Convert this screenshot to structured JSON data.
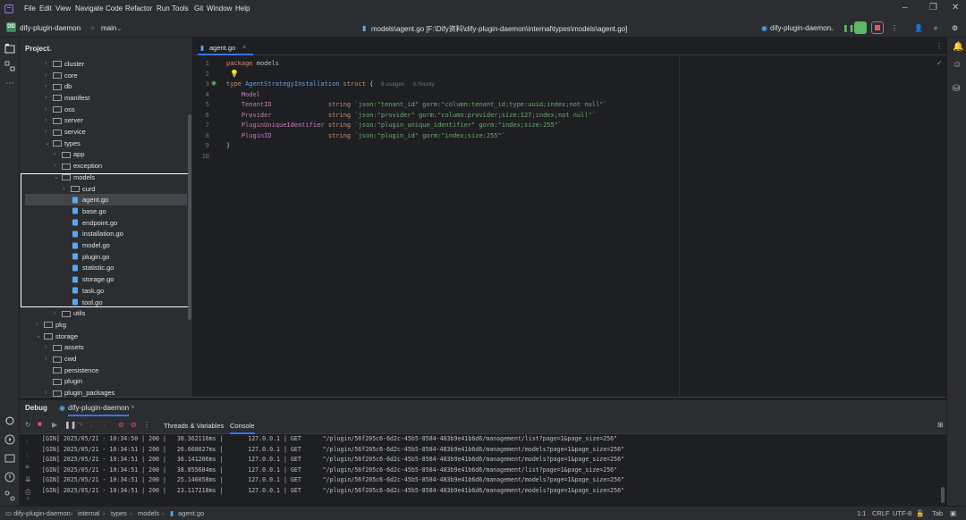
{
  "menu": [
    "File",
    "Edit",
    "View",
    "Navigate",
    "Code",
    "Refactor",
    "Run",
    "Tools",
    "Git",
    "Window",
    "Help"
  ],
  "toolbar": {
    "project_badge": "DD",
    "project_name": "dify-plugin-daemon",
    "branch": "main",
    "path": "models\\agent.go [F:\\Dify资料\\dify-plugin-daemon\\internal\\types\\models\\agent.go]",
    "run_config": "dify-plugin-daemon"
  },
  "project": {
    "header": "Project",
    "tree": [
      {
        "label": "cluster",
        "type": "folder",
        "exp": "closed"
      },
      {
        "label": "core",
        "type": "folder",
        "exp": "closed"
      },
      {
        "label": "db",
        "type": "folder",
        "exp": "closed"
      },
      {
        "label": "manifest",
        "type": "folder",
        "exp": "closed"
      },
      {
        "label": "oss",
        "type": "folder",
        "exp": "closed"
      },
      {
        "label": "server",
        "type": "folder",
        "exp": "closed"
      },
      {
        "label": "service",
        "type": "folder",
        "exp": "closed"
      },
      {
        "label": "types",
        "type": "folder",
        "exp": "open"
      },
      {
        "label": "app",
        "type": "folder",
        "exp": "closed"
      },
      {
        "label": "exception",
        "type": "folder",
        "exp": "closed"
      },
      {
        "label": "models",
        "type": "folder",
        "exp": "open"
      },
      {
        "label": "curd",
        "type": "folder",
        "exp": "closed"
      },
      {
        "label": "agent.go",
        "type": "file",
        "exp": ""
      },
      {
        "label": "base.go",
        "type": "file",
        "exp": ""
      },
      {
        "label": "endpoint.go",
        "type": "file",
        "exp": ""
      },
      {
        "label": "installation.go",
        "type": "file",
        "exp": ""
      },
      {
        "label": "model.go",
        "type": "file",
        "exp": ""
      },
      {
        "label": "plugin.go",
        "type": "file",
        "exp": ""
      },
      {
        "label": "statistic.go",
        "type": "file",
        "exp": ""
      },
      {
        "label": "storage.go",
        "type": "file",
        "exp": ""
      },
      {
        "label": "task.go",
        "type": "file",
        "exp": ""
      },
      {
        "label": "tool.go",
        "type": "file",
        "exp": ""
      },
      {
        "label": "utils",
        "type": "folder",
        "exp": "closed"
      },
      {
        "label": "pkg",
        "type": "folder",
        "exp": "closed"
      },
      {
        "label": "storage",
        "type": "folder",
        "exp": "open"
      },
      {
        "label": "assets",
        "type": "folder",
        "exp": "closed"
      },
      {
        "label": "cwd",
        "type": "folder",
        "exp": "closed"
      },
      {
        "label": "persistence",
        "type": "folder",
        "exp": ""
      },
      {
        "label": "plugin",
        "type": "folder",
        "exp": ""
      },
      {
        "label": "plugin_packages",
        "type": "folder",
        "exp": "closed"
      }
    ]
  },
  "editor": {
    "tab": "agent.go",
    "line_numbers": [
      "1",
      "2",
      "3",
      "4",
      "5",
      "6",
      "7",
      "8",
      "9",
      "10"
    ],
    "code": {
      "l1_kw": "package",
      "l1_name": "models",
      "l3_kw": "type",
      "l3_name": "AgentStrategyInstallation",
      "l3_kw2": "struct",
      "l3_brace": "{",
      "l3_usages": "9 usages",
      "l3_author": "Yeuoly",
      "l4": "Model",
      "fields": [
        {
          "name": "TenantID",
          "type": "string",
          "tag": "`json:\"tenant_id\" gorm:\"column:tenant_id;type:uuid;index;not null\"`"
        },
        {
          "name": "Provider",
          "type": "string",
          "tag": "`json:\"provider\" gorm:\"column:provider;size:127;index;not null\"`"
        },
        {
          "name": "PluginUniqueIdentifier",
          "type": "string",
          "tag": "`json:\"plugin_unique_identifier\" gorm:\"index;size:255\"`"
        },
        {
          "name": "PluginID",
          "type": "string",
          "tag": "`json:\"plugin_id\" gorm:\"index;size:255\"`"
        }
      ],
      "l9": "}"
    }
  },
  "debug": {
    "title": "Debug",
    "session": "dify-plugin-daemon",
    "tabs": [
      "Threads & Variables",
      "Console"
    ],
    "log": [
      "[GIN] 2025/05/21 - 10:34:50 | 200 |   38.362116ms |       127.0.0.1 | GET      \"/plugin/56f205c6-6d2c-45b5-8584-483b9e41b6d6/management/list?page=1&page_size=256\"",
      "[GIN] 2025/05/21 - 10:34:51 | 200 |   26.668027ms |       127.0.0.1 | GET      \"/plugin/56f205c6-6d2c-45b5-8584-483b9e41b6d6/management/models?page=1&page_size=256\"",
      "[GIN] 2025/05/21 - 10:34:51 | 200 |   36.141206ms |       127.0.0.1 | GET      \"/plugin/56f205c6-6d2c-45b5-8584-483b9e41b6d6/management/models?page=1&page_size=256\"",
      "[GIN] 2025/05/21 - 10:34:51 | 200 |   38.855684ms |       127.0.0.1 | GET      \"/plugin/56f205c6-6d2c-45b5-8584-483b9e41b6d6/management/list?page=1&page_size=256\"",
      "[GIN] 2025/05/21 - 10:34:51 | 200 |   25.146058ms |       127.0.0.1 | GET      \"/plugin/56f205c6-6d2c-45b5-8584-483b9e41b6d6/management/models?page=1&page_size=256\"",
      "[GIN] 2025/05/21 - 10:34:51 | 200 |   23.117218ms |       127.0.0.1 | GET      \"/plugin/56f205c6-6d2c-45b5-8584-483b9e41b6d6/management/models?page=1&page_size=256\""
    ]
  },
  "status": {
    "breadcrumb": [
      "dify-plugin-daemon",
      "internal",
      "types",
      "models",
      "agent.go"
    ],
    "position": "1:1",
    "line_sep": "CRLF",
    "encoding": "UTF-8",
    "indent": "Tab"
  },
  "colors": {
    "accent": "#3574f0",
    "run_green": "#5fb865",
    "stop_red": "#e55765"
  }
}
